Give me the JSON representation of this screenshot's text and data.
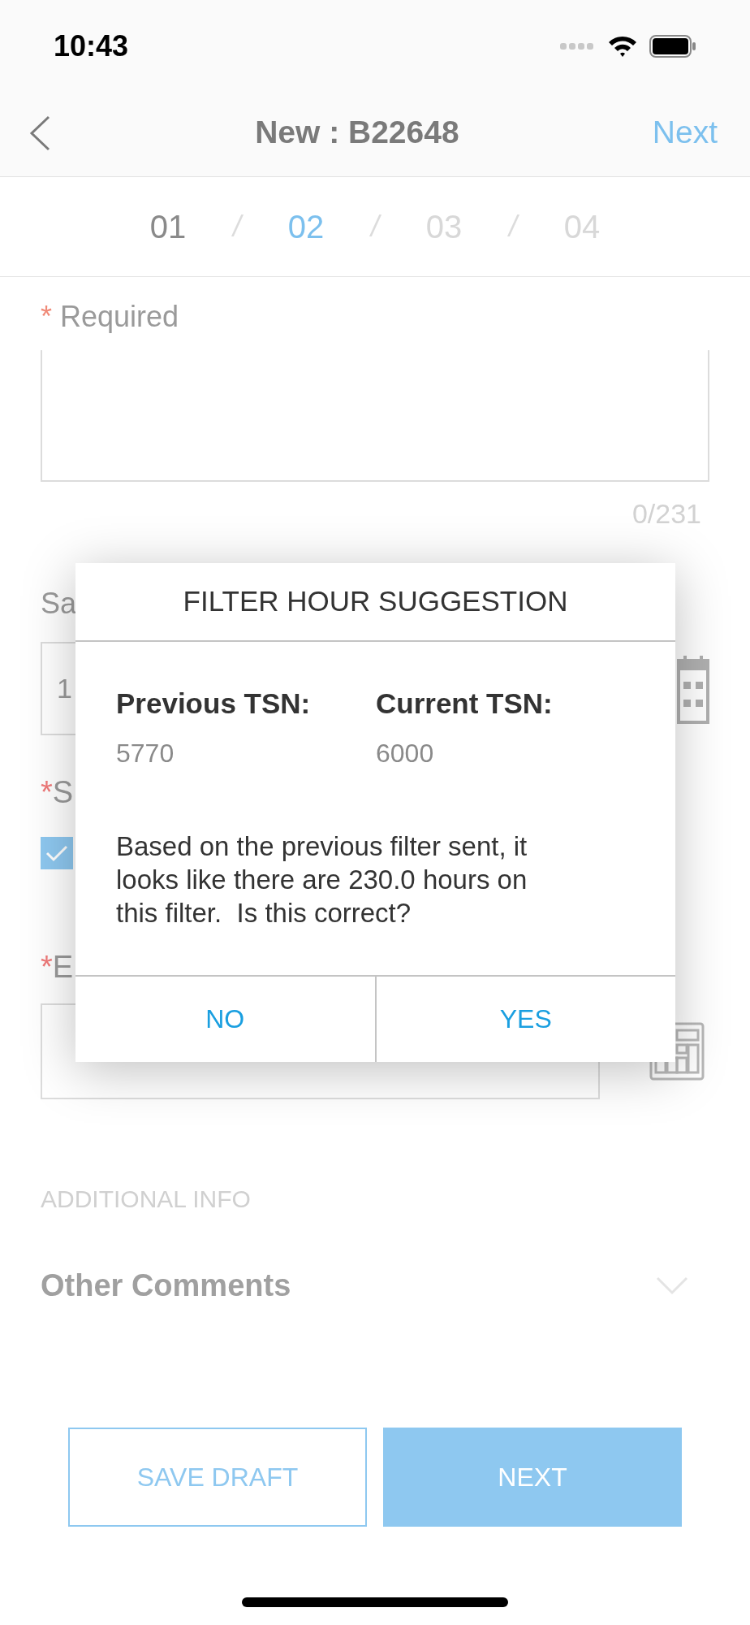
{
  "status_bar": {
    "time": "10:43"
  },
  "nav": {
    "title": "New : B22648",
    "next": "Next"
  },
  "steps": [
    {
      "label": "01",
      "completed": true,
      "selected": false
    },
    {
      "label": "02",
      "completed": false,
      "selected": true
    },
    {
      "label": "03",
      "completed": false,
      "selected": false
    },
    {
      "label": "04",
      "completed": false,
      "selected": false
    }
  ],
  "step_separator": "/",
  "required_note": {
    "mark": "*",
    "text": "Required"
  },
  "textarea": {
    "counter": "0/231"
  },
  "date_section": {
    "label": "Sa",
    "value": "1"
  },
  "checkbox_section": {
    "mark": "*",
    "label": "S",
    "checked": true
  },
  "hours_section": {
    "mark": "*",
    "label": "E"
  },
  "additional_info": {
    "heading": "ADDITIONAL INFO",
    "row": "Other Comments",
    "expanded": false
  },
  "buttons": {
    "save_draft": "SAVE DRAFT",
    "next": "NEXT"
  },
  "dialog": {
    "title": "FILTER HOUR SUGGESTION",
    "fields": [
      {
        "label": "Previous TSN:",
        "value": "5770"
      },
      {
        "label": "Current TSN:",
        "value": "6000"
      }
    ],
    "message": "Based on the previous filter sent, it looks like there are 230.0 hours on this filter.  Is this correct?",
    "actions": [
      {
        "label": "NO"
      },
      {
        "label": "YES"
      }
    ]
  }
}
